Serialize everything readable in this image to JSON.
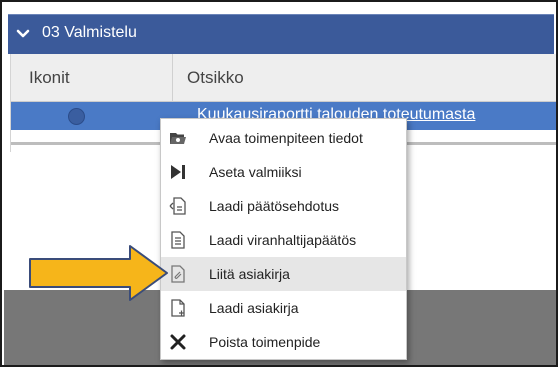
{
  "section": {
    "title": "03 Valmistelu",
    "icon": "chevron-down-icon"
  },
  "grid": {
    "columns": [
      "Ikonit",
      "Otsikko"
    ],
    "rows": [
      {
        "title": "Kuukausiraportti talouden toteutumasta",
        "status_icon": "circle-icon"
      }
    ]
  },
  "context_menu": {
    "items": [
      {
        "label": "Avaa toimenpiteen tiedot",
        "icon": "folder-open-icon"
      },
      {
        "label": "Aseta valmiiksi",
        "icon": "skip-forward-icon"
      },
      {
        "label": "Laadi päätösehdotus",
        "icon": "document-edit-icon"
      },
      {
        "label": "Laadi viranhaltijapäätös",
        "icon": "document-text-icon"
      },
      {
        "label": "Liitä asiakirja",
        "icon": "attach-document-icon"
      },
      {
        "label": "Laadi asiakirja",
        "icon": "new-document-icon"
      },
      {
        "label": "Poista toimenpide",
        "icon": "close-icon"
      }
    ],
    "highlighted_index": 4
  },
  "colors": {
    "header": "#3b5a9a",
    "selected_row": "#4a7ac6",
    "arrow": "#f6b51a",
    "bottom_bar": "#777777"
  }
}
